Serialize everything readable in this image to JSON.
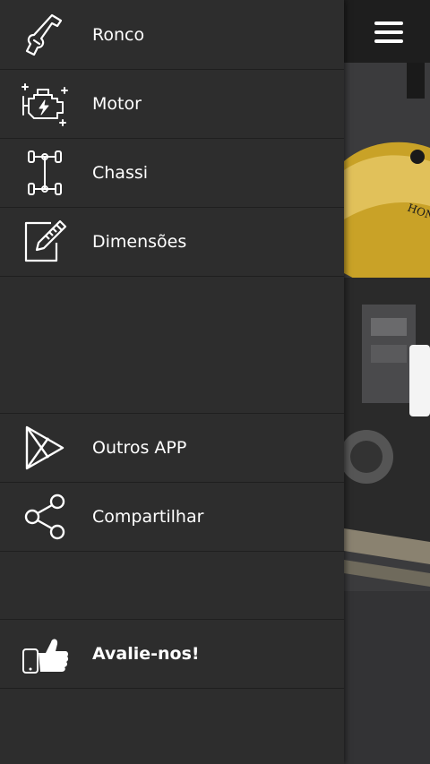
{
  "menu": {
    "items": [
      {
        "label": "Ronco",
        "icon": "exhaust-pipe-icon"
      },
      {
        "label": "Motor",
        "icon": "engine-icon"
      },
      {
        "label": "Chassi",
        "icon": "chassis-icon"
      },
      {
        "label": "Dimensões",
        "icon": "ruler-edit-icon"
      },
      {
        "label": "Outros APP",
        "icon": "play-store-icon"
      },
      {
        "label": "Compartilhar",
        "icon": "share-icon"
      },
      {
        "label": "Avalie-nos!",
        "icon": "thumbs-up-icon"
      }
    ]
  },
  "background": {
    "menu_icon": "hamburger-menu-icon",
    "brand_text": "HONDA"
  },
  "colors": {
    "drawer_bg": "#2d2d2d",
    "text": "#ffffff",
    "accent_photo": "#c9a227"
  }
}
